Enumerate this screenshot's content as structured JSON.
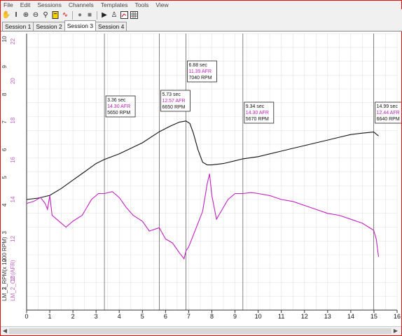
{
  "menu": [
    "File",
    "Edit",
    "Sessions",
    "Channels",
    "Templates",
    "Tools",
    "View"
  ],
  "toolbar": {
    "icons": [
      "hand-icon",
      "zoom-in-icon",
      "zoom-out-icon",
      "zoom-fit-icon",
      "note-icon",
      "signal-icon",
      "record-icon",
      "stop-icon",
      "play-icon",
      "binoculars-icon",
      "xy-plot-icon",
      "grid-icon"
    ]
  },
  "tabs": [
    "Session 1",
    "Session 2",
    "Session 3",
    "Session 4"
  ],
  "active_tab": 2,
  "colors": {
    "rpm": "#111111",
    "afr": "#c020c0",
    "grid": "#e2e2e2",
    "cursor": "#666666",
    "axis_text_left": "#333333",
    "axis_text_right": "#c060c0"
  },
  "chart_data": {
    "type": "line",
    "title": "",
    "xlabel": "",
    "x_ticks": [
      "0",
      "1",
      "2",
      "3",
      "4",
      "5",
      "6",
      "7",
      "8",
      "9",
      "10",
      "11",
      "12",
      "13",
      "14",
      "15",
      "16"
    ],
    "xlim": [
      0,
      16
    ],
    "y_axes": [
      {
        "label": "LM_2_RPM(x 1000 RPM)",
        "ticks": [
          "1",
          "2",
          "3",
          "4",
          "5",
          "6",
          "7",
          "8",
          "9",
          "10"
        ],
        "ylim": [
          0.2,
          10.2
        ]
      },
      {
        "label": "LM_2_O2 (AFR)",
        "ticks": [
          "10",
          "12",
          "14",
          "16",
          "18",
          "20",
          "22"
        ],
        "ylim": [
          8.4,
          22.4
        ]
      }
    ],
    "series": [
      {
        "name": "RPM",
        "axis": 0,
        "x": [
          0,
          0.5,
          1,
          1.5,
          2,
          2.5,
          3,
          3.36,
          4,
          4.5,
          5,
          5.73,
          6.2,
          6.6,
          6.88,
          7.05,
          7.2,
          7.4,
          7.6,
          7.8,
          8,
          8.5,
          9,
          9.34,
          10,
          10.5,
          11,
          11.5,
          12,
          12.5,
          13,
          13.5,
          14,
          14.5,
          14.99,
          15.2
        ],
        "y": [
          4.2,
          4.25,
          4.35,
          4.6,
          4.9,
          5.2,
          5.5,
          5.65,
          5.85,
          6.05,
          6.25,
          6.65,
          6.85,
          7.0,
          7.04,
          6.95,
          6.6,
          6.0,
          5.55,
          5.45,
          5.45,
          5.5,
          5.6,
          5.67,
          5.75,
          5.85,
          5.95,
          6.05,
          6.15,
          6.25,
          6.35,
          6.45,
          6.55,
          6.6,
          6.64,
          6.5
        ]
      },
      {
        "name": "AFR",
        "axis": 1,
        "x": [
          0,
          0.3,
          0.6,
          0.8,
          0.9,
          1.0,
          1.1,
          1.3,
          1.5,
          1.7,
          2.0,
          2.4,
          2.8,
          3.1,
          3.36,
          3.7,
          4.0,
          4.3,
          4.6,
          5.0,
          5.3,
          5.73,
          6.0,
          6.3,
          6.6,
          6.8,
          6.88,
          7.0,
          7.2,
          7.4,
          7.6,
          7.8,
          7.9,
          8.0,
          8.2,
          8.4,
          8.7,
          9.0,
          9.34,
          9.7,
          10.0,
          10.5,
          11.0,
          11.5,
          12.0,
          12.5,
          13.0,
          13.5,
          14.0,
          14.5,
          14.99,
          15.1,
          15.2
        ],
        "y": [
          13.8,
          13.9,
          14.1,
          13.8,
          13.5,
          14.2,
          13.2,
          13.0,
          12.8,
          12.6,
          12.9,
          13.2,
          14.0,
          14.3,
          14.3,
          14.4,
          14.1,
          13.6,
          13.2,
          12.9,
          12.4,
          12.57,
          12.0,
          11.8,
          11.3,
          11.0,
          11.39,
          11.6,
          12.2,
          12.8,
          13.4,
          14.8,
          15.3,
          14.2,
          13.0,
          13.4,
          14.0,
          14.3,
          14.3,
          14.35,
          14.3,
          14.2,
          14.0,
          13.9,
          13.7,
          13.5,
          13.3,
          13.2,
          13.0,
          12.8,
          12.44,
          12.0,
          11.1
        ]
      }
    ],
    "cursors": [
      {
        "x": 3.36,
        "time": "3.36 sec",
        "afr": "14.30 AFR",
        "rpm": "5650 RPM"
      },
      {
        "x": 5.73,
        "time": "5.73 sec",
        "afr": "12.57 AFR",
        "rpm": "6650 RPM"
      },
      {
        "x": 6.88,
        "time": "6.88 sec",
        "afr": "11.39 AFR",
        "rpm": "7040 RPM"
      },
      {
        "x": 9.34,
        "time": "9.34 sec",
        "afr": "14.30 AFR",
        "rpm": "5670 RPM"
      },
      {
        "x": 14.99,
        "time": "14.99 sec",
        "afr": "12.44 AFR",
        "rpm": "6640 RPM"
      }
    ],
    "grid": true
  }
}
